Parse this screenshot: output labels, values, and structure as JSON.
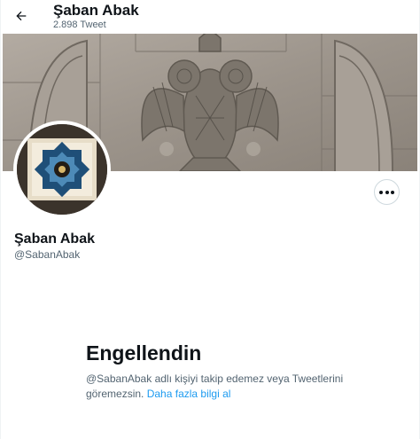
{
  "header": {
    "title": "Şaban Abak",
    "tweet_count": "2.898 Tweet",
    "back_icon": "arrow-left-icon"
  },
  "profile": {
    "display_name": "Şaban Abak",
    "handle": "@SabanAbak",
    "more_icon": "more-horizontal-icon"
  },
  "blocked_notice": {
    "title": "Engellendin",
    "description": "@SabanAbak adlı kişiyi takip edemez veya Tweetlerini göremezsin.",
    "link_label": "Daha fazla bilgi al"
  },
  "colors": {
    "text_primary": "#0f1419",
    "text_secondary": "#536471",
    "link": "#1d9bf0",
    "border": "#cfd9de"
  }
}
